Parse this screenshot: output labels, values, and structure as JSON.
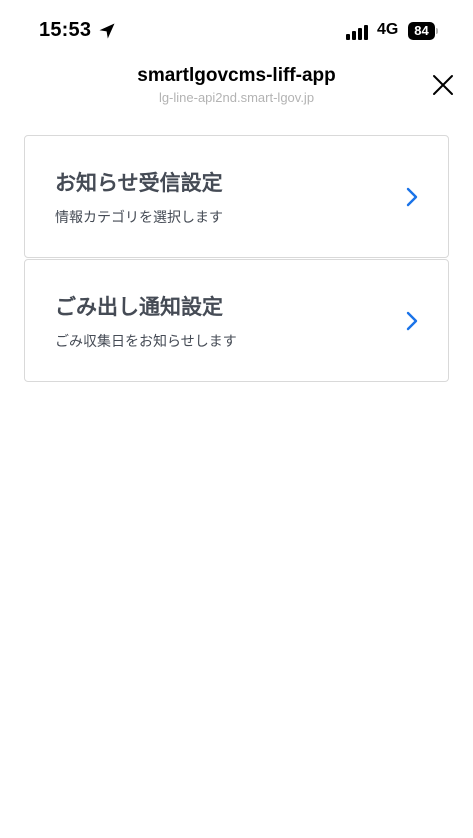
{
  "status_bar": {
    "time": "15:53",
    "network": "4G",
    "battery": "84",
    "icons": [
      "location-arrow-icon",
      "signal-icon",
      "battery-icon"
    ]
  },
  "header": {
    "title": "smartlgovcms-liff-app",
    "subtitle": "lg-line-api2nd.smart-lgov.jp",
    "close_icon": "close-icon"
  },
  "menu": {
    "items": [
      {
        "title": "お知らせ受信設定",
        "description": "情報カテゴリを選択します",
        "icon": "chevron-right-icon"
      },
      {
        "title": "ごみ出し通知設定",
        "description": "ごみ収集日をお知らせします",
        "icon": "chevron-right-icon"
      }
    ]
  },
  "colors": {
    "accent": "#1a73e8",
    "text": "#454b55",
    "border": "#d9d9d9",
    "subtitle": "#b3b3b3"
  }
}
